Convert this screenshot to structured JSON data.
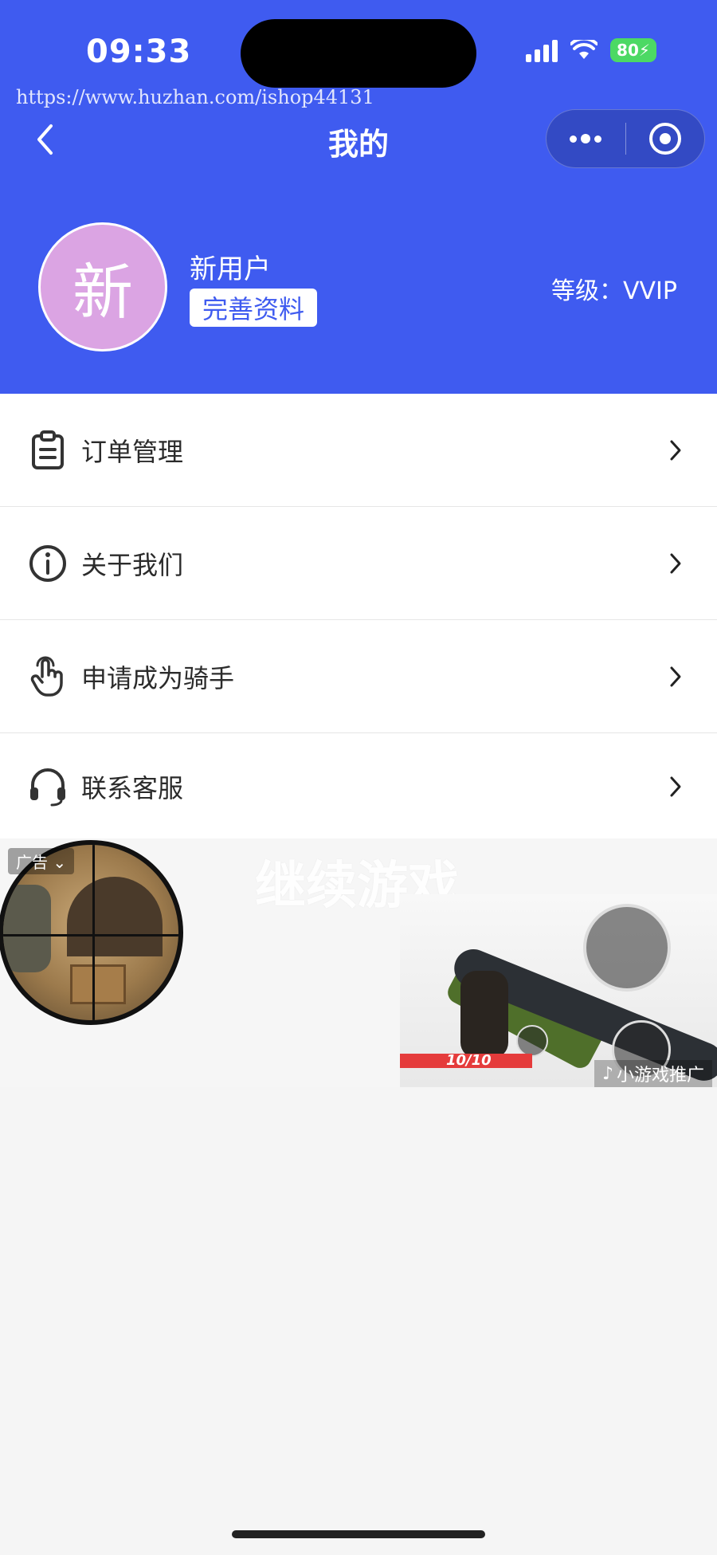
{
  "status_bar": {
    "time": "09:33",
    "battery": "80"
  },
  "watermark": "https://www.huzhan.com/ishop44131",
  "nav": {
    "title": "我的"
  },
  "profile": {
    "avatar_char": "新",
    "username": "新用户",
    "complete_profile_label": "完善资料",
    "level_text": "等级：VVIP"
  },
  "menu": {
    "items": [
      {
        "label": "订单管理",
        "icon": "clipboard-icon"
      },
      {
        "label": "关于我们",
        "icon": "info-icon"
      },
      {
        "label": "申请成为骑手",
        "icon": "hand-pointer-icon"
      },
      {
        "label": "联系客服",
        "icon": "headset-icon"
      }
    ]
  },
  "ad": {
    "title": "继续游戏",
    "tag": "广告",
    "ammo": "10/10",
    "promo": "小游戏推广"
  },
  "colors": {
    "header_bg": "#3f5bf0",
    "avatar_bg": "#dba4e3",
    "battery": "#4cd964"
  }
}
